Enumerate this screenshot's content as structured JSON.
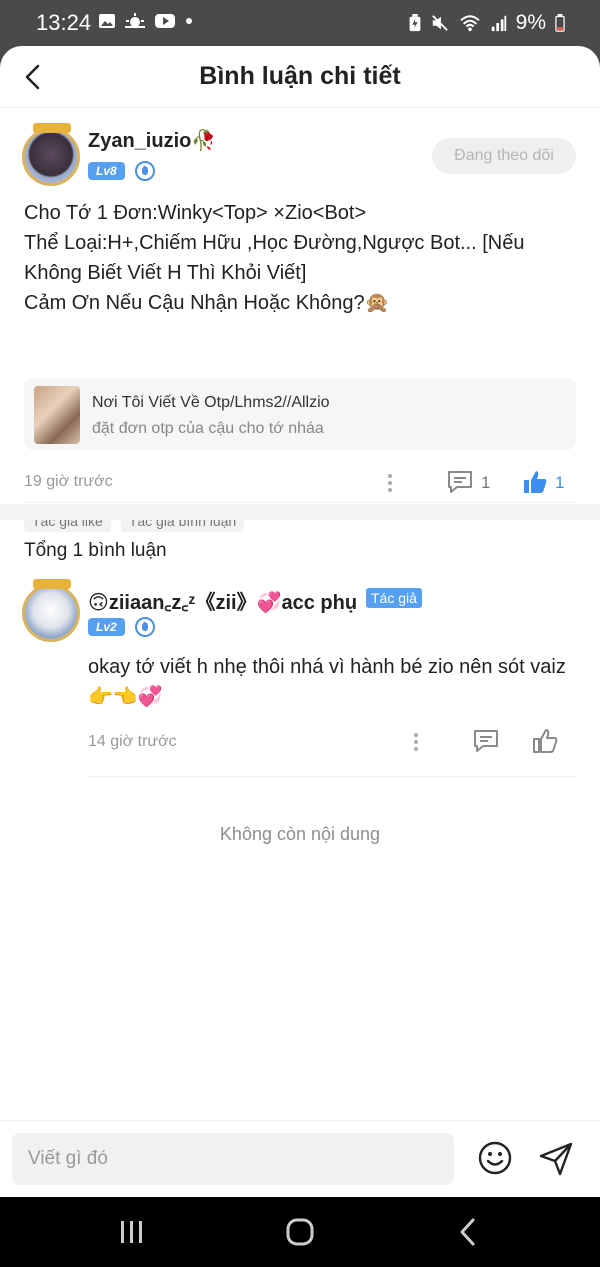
{
  "status_bar": {
    "time": "13:24",
    "battery": "9%",
    "left_icons": [
      "gallery-icon",
      "weather-icon",
      "youtube-icon",
      "dot-icon"
    ],
    "right_icons": [
      "battery-saver-icon",
      "mute-icon",
      "wifi-icon",
      "signal-icon",
      "battery-icon"
    ]
  },
  "header": {
    "title": "Bình luận chi tiết"
  },
  "post": {
    "username": "Zyan_iuzio🥀",
    "level": "Lv8",
    "follow_label": "Đang theo dõi",
    "lines": [
      "Cho Tớ 1 Đơn:Winky<Top> ×Zio<Bot>",
      "Thể Loại:H+,Chiếm Hữu ,Học Đường,Ngược Bot... [Nếu Không Biết Viết H Thì Khỏi Viết]",
      "Cảm Ơn Nếu Cậu Nhận Hoặc Không?🙊"
    ],
    "link_card": {
      "title": "Nơi Tôi Viết Về Otp/Lhms2//Allzio",
      "subtitle": "đặt đơn otp của cậu cho tớ nháa"
    },
    "time_ago": "19 giờ trước",
    "comment_count": "1",
    "like_count": "1",
    "tags": [
      "Tác giả like",
      "Tác giả bình luận"
    ]
  },
  "comments_section": {
    "total_label": "Tổng 1 bình luận",
    "comments": [
      {
        "username": "🙃ziiaan꜀z꜀ᶻ《zii》💞acc phụ",
        "author_badge": "Tác giả",
        "level": "Lv2",
        "text": "okay tớ viết h nhẹ thôi nhá vì hành bé zio nên sót vaiz 👉👈💞",
        "time_ago": "14 giờ trước"
      }
    ],
    "end_label": "Không còn nội dung"
  },
  "input_bar": {
    "placeholder": "Viết gì đó"
  },
  "colors": {
    "accent": "#3c8ff0",
    "level_badge": "#56a0f2",
    "muted_text": "#9a9a9a"
  }
}
